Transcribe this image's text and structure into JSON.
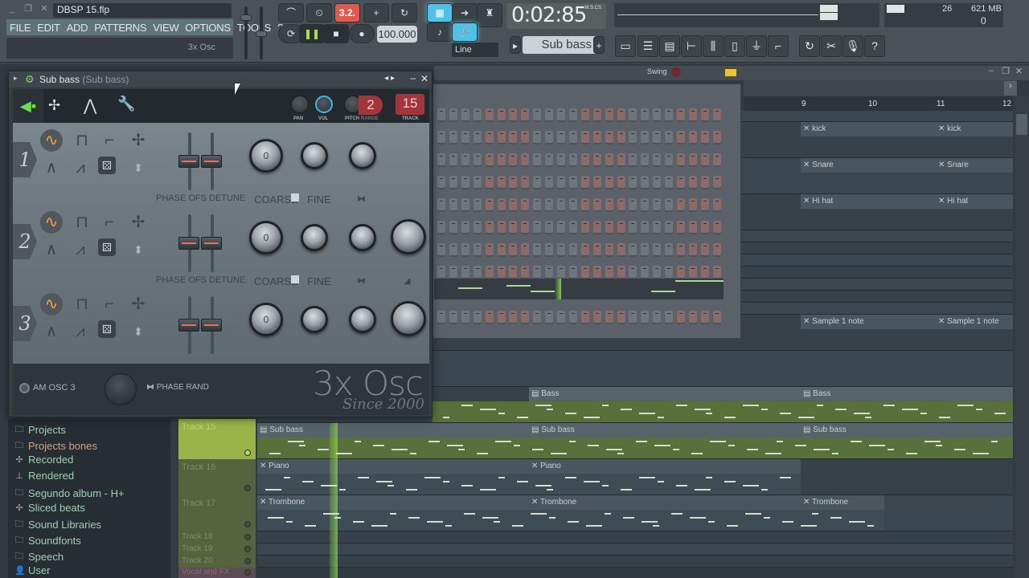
{
  "window": {
    "file_title": "DBSP 15.flp",
    "hint": "3x Osc"
  },
  "menu": [
    "FILE",
    "EDIT",
    "ADD",
    "PATTERNS",
    "VIEW",
    "OPTIONS",
    "TOOLS",
    "?"
  ],
  "transport": {
    "pattern_song_label": "3.2.",
    "tempo": "100.000",
    "time": "0:02:85",
    "time_format": "M:S:CS",
    "snap": "Line",
    "pattern": "Sub bass"
  },
  "cpu": {
    "voices": "26",
    "memory": "621 MB",
    "poly": "0"
  },
  "toolbar_icons": [
    "playlist-icon",
    "channel-rack-icon",
    "piano-roll-icon",
    "browser-icon",
    "mixer-icon",
    "project-icon",
    "plugin-icon",
    "stamp-icon"
  ],
  "toolbar_icons2": [
    "undo-icon",
    "cut-icon",
    "record-mic-icon",
    "help-icon"
  ],
  "swing_label": "Swing",
  "ruler": [
    "9",
    "10",
    "11",
    "12"
  ],
  "plugin": {
    "title": "Sub bass",
    "subtitle": "(Sub bass)",
    "pan_label": "PAN",
    "vol_label": "VOL",
    "pitch_label": "PITCH",
    "range_label": "RANGE",
    "range_value": "2",
    "track_label": "TRACK",
    "track_value": "15",
    "oscillators": [
      {
        "num": "1",
        "coarse": "0"
      },
      {
        "num": "2",
        "coarse": "0"
      },
      {
        "num": "3",
        "coarse": "0"
      }
    ],
    "phase_ofs_label": "PHASE OFS",
    "detune_label": "DETUNE",
    "coarse_label": "COARSE",
    "fine_label": "FINE",
    "am_label": "AM OSC 3",
    "phase_rand_label": "PHASE RAND",
    "logo": "3x Osc",
    "since": "Since 2000"
  },
  "browser": [
    {
      "icon": "folder",
      "label": "Projects",
      "color": "#9fd0b0"
    },
    {
      "icon": "folder",
      "label": "Projects bones",
      "color": "#d9a07f"
    },
    {
      "icon": "wave",
      "label": "Recorded",
      "color": "#9fd0b0"
    },
    {
      "icon": "render",
      "label": "Rendered",
      "color": "#9fd0b0"
    },
    {
      "icon": "folder",
      "label": "Segundo album - H+",
      "color": "#9fd0b0"
    },
    {
      "icon": "wave",
      "label": "Sliced beats",
      "color": "#9fd0b0"
    },
    {
      "icon": "folder",
      "label": "Sound Libraries",
      "color": "#9fd0b0"
    },
    {
      "icon": "folder",
      "label": "Soundfonts",
      "color": "#9fd0b0"
    },
    {
      "icon": "folder",
      "label": "Speech",
      "color": "#9fd0b0"
    },
    {
      "icon": "user",
      "label": "User",
      "color": "#9fd0b0"
    }
  ],
  "tracks": [
    {
      "label": "Track 15",
      "active": true
    },
    {
      "label": "Track 16",
      "active": false
    },
    {
      "label": "Track 17",
      "active": false
    },
    {
      "label": "Track 18",
      "active": false
    },
    {
      "label": "Track 19",
      "active": false
    },
    {
      "label": "Track 20",
      "active": false
    },
    {
      "label": "Vocal and FX",
      "active": false
    }
  ],
  "clips": {
    "kick": "kick",
    "snare": "Snare",
    "hihat": "Hi hat",
    "sample": "Sample 1 note",
    "bass": "Bass",
    "subbass": "Sub bass",
    "piano": "Piano",
    "trombone": "Trombone"
  }
}
